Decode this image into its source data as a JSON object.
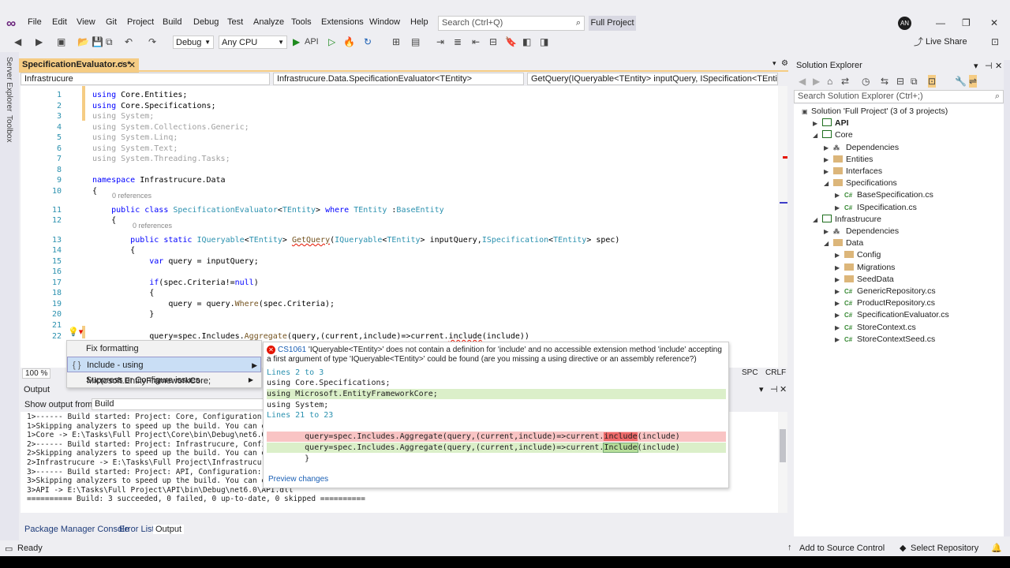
{
  "menu": [
    "File",
    "Edit",
    "View",
    "Git",
    "Project",
    "Build",
    "Debug",
    "Test",
    "Analyze",
    "Tools",
    "Extensions",
    "Window",
    "Help"
  ],
  "search_placeholder": "Search (Ctrl+Q)",
  "project_name": "Full Project",
  "avatar": "AN",
  "toolbar": {
    "config": "Debug",
    "platform": "Any CPU",
    "run_target": "API",
    "live_share": "Live Share"
  },
  "side_tabs": [
    "Server Explorer",
    "Toolbox"
  ],
  "editor": {
    "tab_title": "SpecificationEvaluator.cs*",
    "nav_project": "Infrastrucure",
    "nav_type": "Infrastrucure.Data.SpecificationEvaluator<TEntity>",
    "nav_member": "GetQuery(IQueryable<TEntity> inputQuery, ISpecification<TEntity> s",
    "zoom": "100 %",
    "status_spc": "SPC",
    "status_crlf": "CRLF",
    "refs": [
      "0 references",
      "0 references"
    ]
  },
  "code_lines": [
    {
      "n": "1",
      "t": "using Core.Entities;"
    },
    {
      "n": "2",
      "t": "using Core.Specifications;"
    },
    {
      "n": "3",
      "t": "using System;"
    },
    {
      "n": "4",
      "t": "using System.Collections.Generic;"
    },
    {
      "n": "5",
      "t": "using System.Linq;"
    },
    {
      "n": "6",
      "t": "using System.Text;"
    },
    {
      "n": "7",
      "t": "using System.Threading.Tasks;"
    },
    {
      "n": "8",
      "t": ""
    },
    {
      "n": "9",
      "t": "namespace Infrastrucure.Data"
    },
    {
      "n": "10",
      "t": "{"
    },
    {
      "n": "11",
      "t": "    public class SpecificationEvaluator<TEntity> where TEntity :BaseEntity"
    },
    {
      "n": "12",
      "t": "    {"
    },
    {
      "n": "13",
      "t": "        public static IQueryable<TEntity> GetQuery(IQueryable<TEntity> inputQuery,ISpecification<TEntity> spec)"
    },
    {
      "n": "14",
      "t": "        {"
    },
    {
      "n": "15",
      "t": "            var query = inputQuery;"
    },
    {
      "n": "16",
      "t": ""
    },
    {
      "n": "17",
      "t": "            if(spec.Criteria!=null)"
    },
    {
      "n": "18",
      "t": "            {"
    },
    {
      "n": "19",
      "t": "                query = query.Where(spec.Criteria);"
    },
    {
      "n": "20",
      "t": "            }"
    },
    {
      "n": "21",
      "t": ""
    },
    {
      "n": "22",
      "t": "            query=spec.Includes.Aggregate(query,(current,include)=>current.include(include))"
    }
  ],
  "quick_actions": [
    "Fix formatting",
    "Include - using Microsoft.EntityFrameworkCore;",
    "Suppress or Configure issues"
  ],
  "preview": {
    "error_code": "CS1061",
    "error_text": "'IQueryable<TEntity>' does not contain a definition for 'include' and no accessible extension method 'include' accepting a first argument of type 'IQueryable<TEntity>' could be found (are you missing a using directive or an assembly reference?)",
    "hdr1": "Lines 2 to 3",
    "l1": "using Core.Specifications;",
    "l2": "using Microsoft.EntityFrameworkCore;",
    "l3": "using System;",
    "hdr2": "Lines 21 to 23",
    "rem_pre": "        query=spec.Includes.Aggregate(query,(current,include)=>current.",
    "rem_hl": "include",
    "rem_post": "(include)",
    "add_pre": "        query=spec.Includes.Aggregate(query,(current,include)=>current.",
    "add_hl": "Include",
    "add_post": "(include)",
    "close": "        }",
    "link": "Preview changes"
  },
  "output": {
    "title": "Output",
    "show_from_label": "Show output from:",
    "show_from_value": "Build",
    "lines": [
      "1>------ Build started: Project: Core, Configuration:",
      "1>Skipping analyzers to speed up the build. You can e",
      "1>Core -> E:\\Tasks\\Full Project\\Core\\bin\\Debug\\net6.0",
      "2>------ Build started: Project: Infrastrucure, Confi",
      "2>Skipping analyzers to speed up the build. You can e",
      "2>Infrastrucure -> E:\\Tasks\\Full Project\\Infrastrucur",
      "3>------ Build started: Project: API, Configuration:",
      "3>Skipping analyzers to speed up the build. You can e",
      "3>API -> E:\\Tasks\\Full Project\\API\\bin\\Debug\\net6.0\\API.dll",
      "========== Build: 3 succeeded, 0 failed, 0 up-to-date, 0 skipped =========="
    ]
  },
  "bottom_tabs": [
    "Package Manager Console",
    "Error List",
    "Output"
  ],
  "solution_explorer": {
    "title": "Solution Explorer",
    "search_placeholder": "Search Solution Explorer (Ctrl+;)",
    "items": [
      {
        "label": "Solution 'Full Project' (3 of 3 projects)",
        "kind": "solution",
        "level": 0
      },
      {
        "label": "API",
        "kind": "project",
        "level": 1,
        "bold": true
      },
      {
        "label": "Core",
        "kind": "project",
        "level": 1
      },
      {
        "label": "Dependencies",
        "kind": "deps",
        "level": 2
      },
      {
        "label": "Entities",
        "kind": "folder",
        "level": 2
      },
      {
        "label": "Interfaces",
        "kind": "folder",
        "level": 2
      },
      {
        "label": "Specifications",
        "kind": "folder",
        "level": 2
      },
      {
        "label": "BaseSpecification.cs",
        "kind": "cs",
        "level": 3
      },
      {
        "label": "ISpecification.cs",
        "kind": "cs",
        "level": 3
      },
      {
        "label": "Infrastrucure",
        "kind": "project",
        "level": 1
      },
      {
        "label": "Dependencies",
        "kind": "deps",
        "level": 2
      },
      {
        "label": "Data",
        "kind": "folder",
        "level": 2
      },
      {
        "label": "Config",
        "kind": "folder",
        "level": 3
      },
      {
        "label": "Migrations",
        "kind": "folder",
        "level": 3
      },
      {
        "label": "SeedData",
        "kind": "folder",
        "level": 3
      },
      {
        "label": "GenericRepository.cs",
        "kind": "cs",
        "level": 3
      },
      {
        "label": "ProductRepository.cs",
        "kind": "cs",
        "level": 3
      },
      {
        "label": "SpecificationEvaluator.cs",
        "kind": "cs",
        "level": 3
      },
      {
        "label": "StoreContext.cs",
        "kind": "cs",
        "level": 3
      },
      {
        "label": "StoreContextSeed.cs",
        "kind": "cs",
        "level": 3
      }
    ]
  },
  "status": {
    "ready": "Ready",
    "source_control": "Add to Source Control",
    "repo": "Select Repository"
  }
}
